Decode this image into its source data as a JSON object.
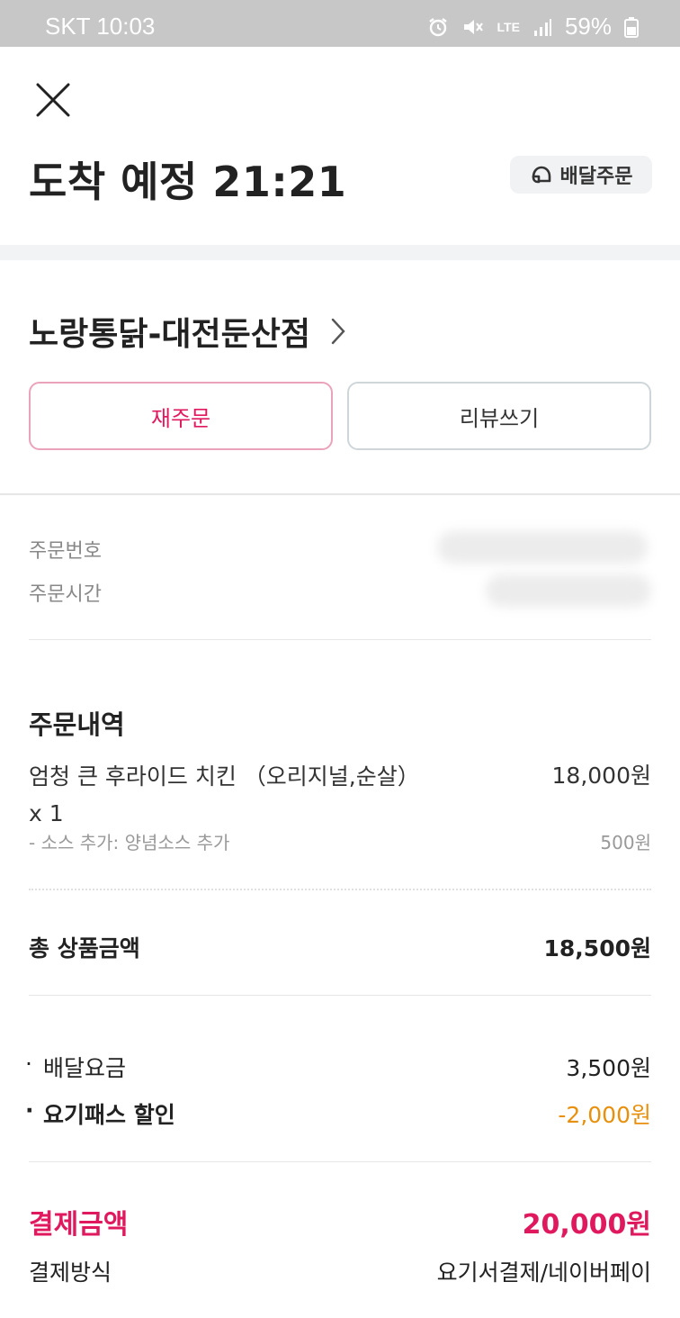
{
  "status_bar": {
    "carrier_time": "SKT 10:03",
    "network": "LTE",
    "battery": "59%"
  },
  "header": {
    "eta": "도착 예정 21:21",
    "badge": "배달주문"
  },
  "store": {
    "name": "노랑통닭-대전둔산점"
  },
  "buttons": {
    "reorder": "재주문",
    "review": "리뷰쓰기"
  },
  "meta": {
    "order_number_label": "주문번호",
    "order_time_label": "주문시간"
  },
  "order": {
    "title": "주문내역",
    "item_name": "엄청 큰 후라이드 치킨 （오리지널,순살）",
    "item_qty": "x 1",
    "item_price": "18,000원",
    "option_name": "- 소스 추가: 양념소스 추가",
    "option_price": "500원"
  },
  "totals": {
    "subtotal_label": "총 상품금액",
    "subtotal_value": "18,500원",
    "delivery_label": "배달요금",
    "delivery_value": "3,500원",
    "discount_label": "요기패스 할인",
    "discount_value": "-2,000원",
    "payment_label": "결제금액",
    "payment_value": "20,000원",
    "method_label": "결제방식",
    "method_value": "요기서결제/네이버페이"
  },
  "colors": {
    "accent": "#e0195f",
    "discount": "#e8900c",
    "status_bar": "#c7c7c7"
  }
}
